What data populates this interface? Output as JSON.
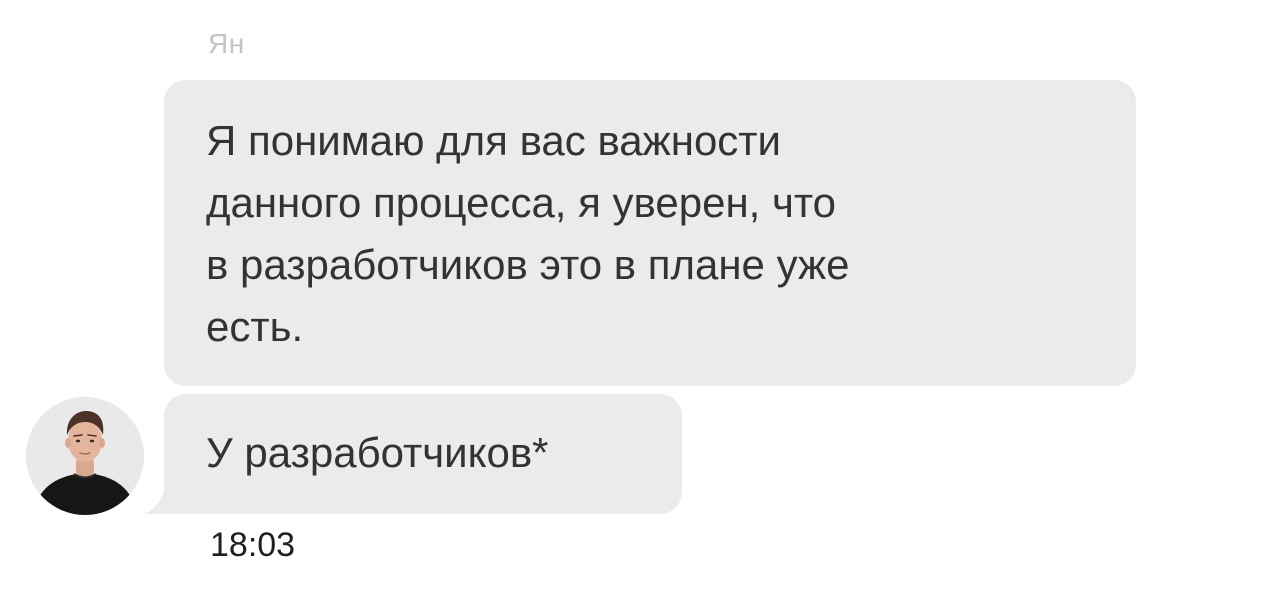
{
  "sender": {
    "name": "Ян"
  },
  "messages": [
    {
      "lines": [
        "Я понимаю для вас важности",
        "данного процесса, я уверен, что",
        "в разработчиков это в плане уже",
        "есть."
      ]
    },
    {
      "text": "У разработчиков*"
    }
  ],
  "timestamp": "18:03",
  "avatar": {
    "icon": "user-avatar-photo"
  },
  "colors": {
    "bubble": "#eaebed",
    "text": "#333333",
    "sender_name": "#c4c4c4",
    "timestamp": "#1f1f1f"
  }
}
